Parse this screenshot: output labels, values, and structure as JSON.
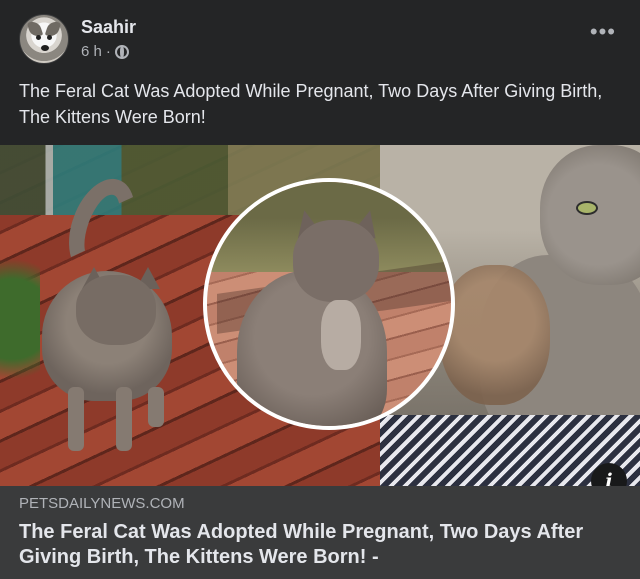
{
  "post": {
    "author": "Saahir",
    "time": "6 h",
    "separator": "·",
    "audience_icon": "globe-icon",
    "more_icon": "more-options-icon",
    "more_glyph": "•••",
    "caption": "The Feral Cat Was Adopted While Pregnant, Two Days After Giving Birth, The Kittens Were Born!"
  },
  "media": {
    "info_glyph": "i",
    "info_icon": "info-icon"
  },
  "link": {
    "domain": "PETSDAILYNEWS.COM",
    "title": "The Feral Cat Was Adopted While Pregnant, Two Days After Giving Birth, The Kittens Were Born! -"
  },
  "colors": {
    "card_bg": "#242526",
    "link_bg": "#3a3b3c",
    "primary_text": "#e4e6eb",
    "secondary_text": "#b0b3b8"
  }
}
